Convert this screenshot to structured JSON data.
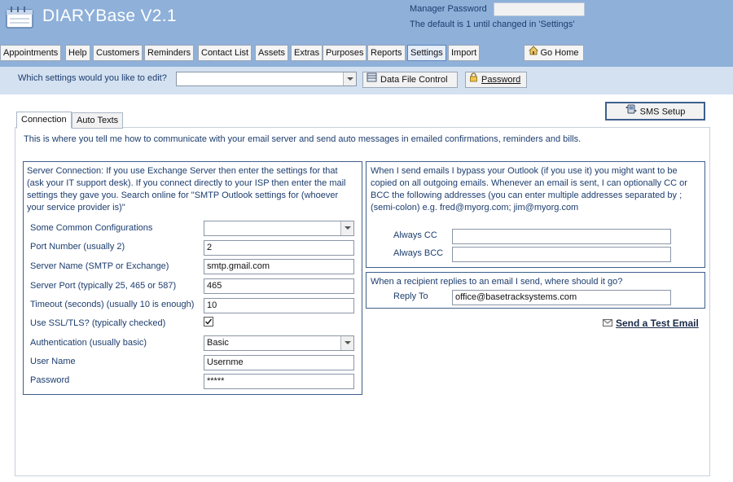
{
  "app": {
    "title": "DIARYBase V2.1",
    "manager_password_label": "Manager Password",
    "manager_password_value": "",
    "manager_note": "The default is 1 until changed in 'Settings'"
  },
  "nav": {
    "items": [
      "Appointments",
      "Help",
      "Customers",
      "Reminders",
      "Contact List",
      "Assets",
      "Extras",
      "Purposes",
      "Reports",
      "Settings",
      "Import"
    ],
    "active": "Settings",
    "go_home": "Go Home"
  },
  "settings_bar": {
    "which_label": "Which settings would you like to edit?",
    "which_value": "",
    "data_file_button": "Data File Control",
    "password_button": "Password"
  },
  "sms_button": "SMS Setup",
  "tabs": [
    "Connection",
    "Auto Texts"
  ],
  "active_tab": "Connection",
  "intro": "This is where you tell me how to communicate with your email server and send auto messages in emailed confirmations, reminders and bills.",
  "server_group": {
    "description_lines": [
      "Server Connection: If you use Exchange Server then enter the settings for that",
      "(ask your IT support desk). If you connect directly to your ISP then enter the mail",
      "settings they gave you. Search online for \"SMTP Outlook settings for (whoever",
      "your service provider is)\""
    ],
    "fields": {
      "common_config": {
        "label": "Some Common Configurations",
        "value": ""
      },
      "port_number": {
        "label": "Port Number (usually 2)",
        "value": "2"
      },
      "server_name": {
        "label": "Server Name (SMTP or Exchange)",
        "value": "smtp.gmail.com"
      },
      "server_port": {
        "label": "Server Port (typically 25, 465 or 587)",
        "value": "465"
      },
      "timeout": {
        "label": "Timeout (seconds) (usually 10 is enough)",
        "value": "10"
      },
      "ssl": {
        "label": "Use SSL/TLS? (typically checked)",
        "checked": true
      },
      "authentication": {
        "label": "Authentication (usually basic)",
        "value": "Basic"
      },
      "user_name": {
        "label": "User Name",
        "value": "Usernme"
      },
      "password": {
        "label": "Password",
        "value": "*****"
      }
    }
  },
  "cc_group": {
    "description_lines": [
      "When I send emails I bypass your Outlook (if you use it) you might want to be",
      "copied on all outgoing emails. Whenever an email is sent, I can optionally CC or",
      "BCC the following addresses (you can enter multiple addresses separated by ;",
      "(semi-colon) e.g. fred@myorg.com; jim@myorg.com"
    ],
    "always_cc": {
      "label": "Always CC",
      "value": ""
    },
    "always_bcc": {
      "label": "Always BCC",
      "value": ""
    }
  },
  "reply_group": {
    "description": "When a recipient replies to an email I send, where should it go?",
    "reply_to": {
      "label": "Reply To",
      "value": "office@basetracksystems.com"
    }
  },
  "send_test_email": "Send a Test Email",
  "colors": {
    "header_bg": "#8eb0d9",
    "settings_bar_bg": "#d4e1f1",
    "label_text": "#1c3d6e",
    "group_border": "#3f5f8c"
  },
  "icons": {
    "logo": "calendar-icon",
    "go_home": "home-icon",
    "data_file": "database-icon",
    "password": "lock-icon",
    "sms": "phone-icon",
    "test_email": "envelope-icon"
  }
}
